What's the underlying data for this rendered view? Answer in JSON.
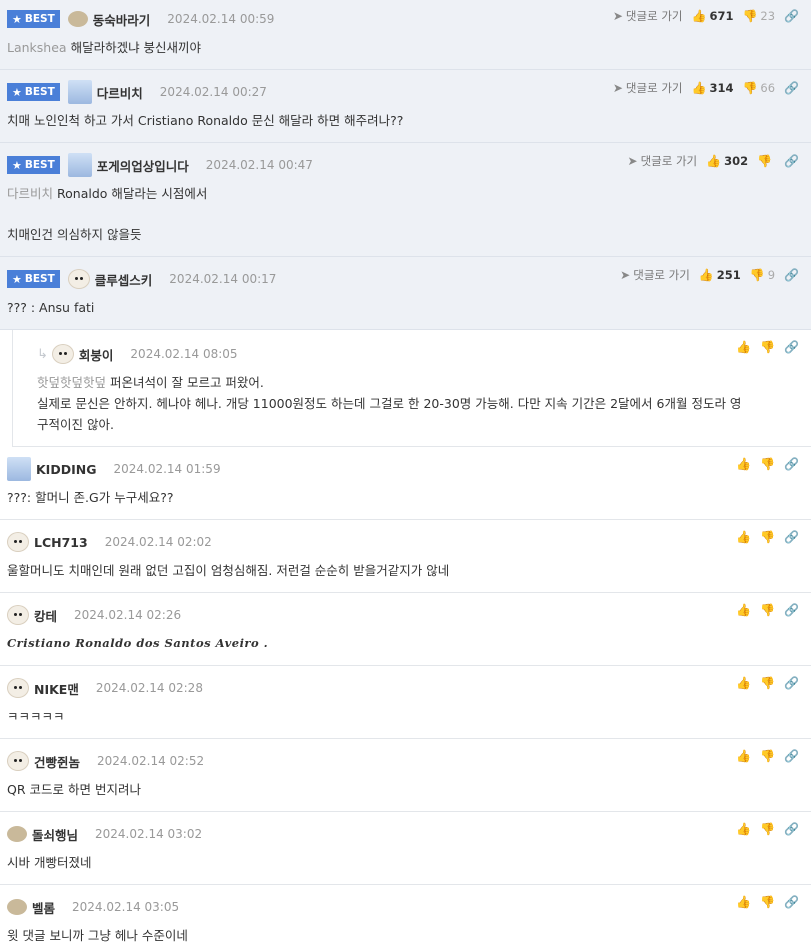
{
  "reply_label": "댓글로 가기",
  "badge_label": "BEST",
  "best_comments": [
    {
      "nick": "동숙바라기",
      "time": "2024.02.14 00:59",
      "up": "671",
      "down": "23",
      "quote": "Lankshea",
      "text": "해달라하겠냐 붕신새끼야",
      "avatar": "tan"
    },
    {
      "nick": "다르비치",
      "time": "2024.02.14 00:27",
      "up": "314",
      "down": "66",
      "quote": "",
      "text": "치매 노인인척 하고 가서 Cristiano Ronaldo 문신 해달라 하면 해주려나??",
      "avatar": "blue"
    },
    {
      "nick": "포게의업상입니다",
      "time": "2024.02.14 00:47",
      "up": "302",
      "down": "",
      "quote": "다르비치",
      "text": "Ronaldo 해달라는 시점에서",
      "text2": "치매인건 의심하지 않을듯",
      "avatar": "blue"
    },
    {
      "nick": "클루셉스키",
      "time": "2024.02.14 00:17",
      "up": "251",
      "down": "9",
      "quote": "",
      "text": "??? : Ansu fati",
      "avatar": "pup"
    }
  ],
  "reply": {
    "nick": "회붕이",
    "time": "2024.02.14 08:05",
    "quote": "핫덮핫덮핫덮",
    "line1": "퍼온녀석이 잘 모르고 퍼왔어.",
    "line2": "실제로 문신은 안하지. 헤나야 헤나. 개당 11000원정도 하는데 그걸로 한 20-30명 가능해. 다만 지속 기간은 2달에서 6개월 정도라 영",
    "line3": "구적이진 않아."
  },
  "comments": [
    {
      "nick": "KIDDING",
      "time": "2024.02.14 01:59",
      "text": "???: 할머니 존.G가 누구세요??",
      "avatar": "blue"
    },
    {
      "nick": "LCH713",
      "time": "2024.02.14 02:02",
      "text": "울할머니도 치매인데 원래 없던 고집이 엄청심해짐. 저런걸 순순히 받을거같지가 않네",
      "avatar": "pup"
    },
    {
      "nick": "캉테",
      "time": "2024.02.14 02:26",
      "text": "Cristiano Ronaldo dos Santos Aveiro .",
      "avatar": "pup",
      "script": true
    },
    {
      "nick": "NIKE맨",
      "time": "2024.02.14 02:28",
      "text": "ㅋㅋㅋㅋㅋ",
      "avatar": "pup"
    },
    {
      "nick": "건빵쥔놈",
      "time": "2024.02.14 02:52",
      "text": "QR 코드로 하면 번지려나",
      "avatar": "pup"
    },
    {
      "nick": "돌쇠행님",
      "time": "2024.02.14 03:02",
      "text": "시바 개빵터졌네",
      "avatar": "tan"
    },
    {
      "nick": "벨롬",
      "time": "2024.02.14 03:05",
      "text": "윗 댓글 보니까 그냥 헤나 수준이네",
      "avatar": "tan"
    }
  ]
}
